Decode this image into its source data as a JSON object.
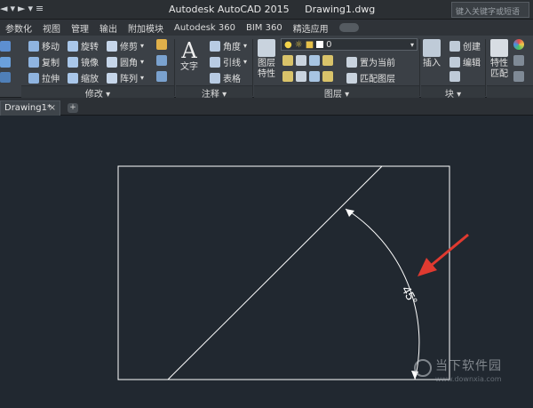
{
  "app": {
    "title": "Autodesk AutoCAD 2015",
    "file": "Drawing1.dwg",
    "search_placeholder": "键入关键字或短语"
  },
  "menu": {
    "items": [
      "参数化",
      "视图",
      "管理",
      "输出",
      "附加模块",
      "Autodesk 360",
      "BIM 360",
      "精选应用"
    ]
  },
  "ribbon": {
    "modify": {
      "label": "修改",
      "rows": [
        [
          "移动",
          "旋转",
          "修剪"
        ],
        [
          "复制",
          "镜像",
          "圆角"
        ],
        [
          "拉伸",
          "缩放",
          "阵列"
        ]
      ]
    },
    "annotation": {
      "label": "注释",
      "text_label": "文字",
      "angle": "角度",
      "leader": "引线",
      "table": "表格"
    },
    "layers": {
      "label": "图层",
      "props_label": "图层特性",
      "current_layer": "0",
      "set_current": "置为当前",
      "match_layer": "匹配图层"
    },
    "block": {
      "label": "块",
      "insert": "插入",
      "create": "创建",
      "edit": "编辑"
    },
    "properties": {
      "label": "特性匹配"
    }
  },
  "tabs": {
    "doc_tab": "Drawing1*",
    "close": "×",
    "add": "+"
  },
  "drawing": {
    "angle_text": "45°"
  },
  "watermark": {
    "name": "当下软件园",
    "url": "www.downxia.com"
  },
  "colors": {
    "canvas": "#212830",
    "line": "#ffffff",
    "arrow": "#e03a30",
    "ribbon": "#3b4046"
  }
}
